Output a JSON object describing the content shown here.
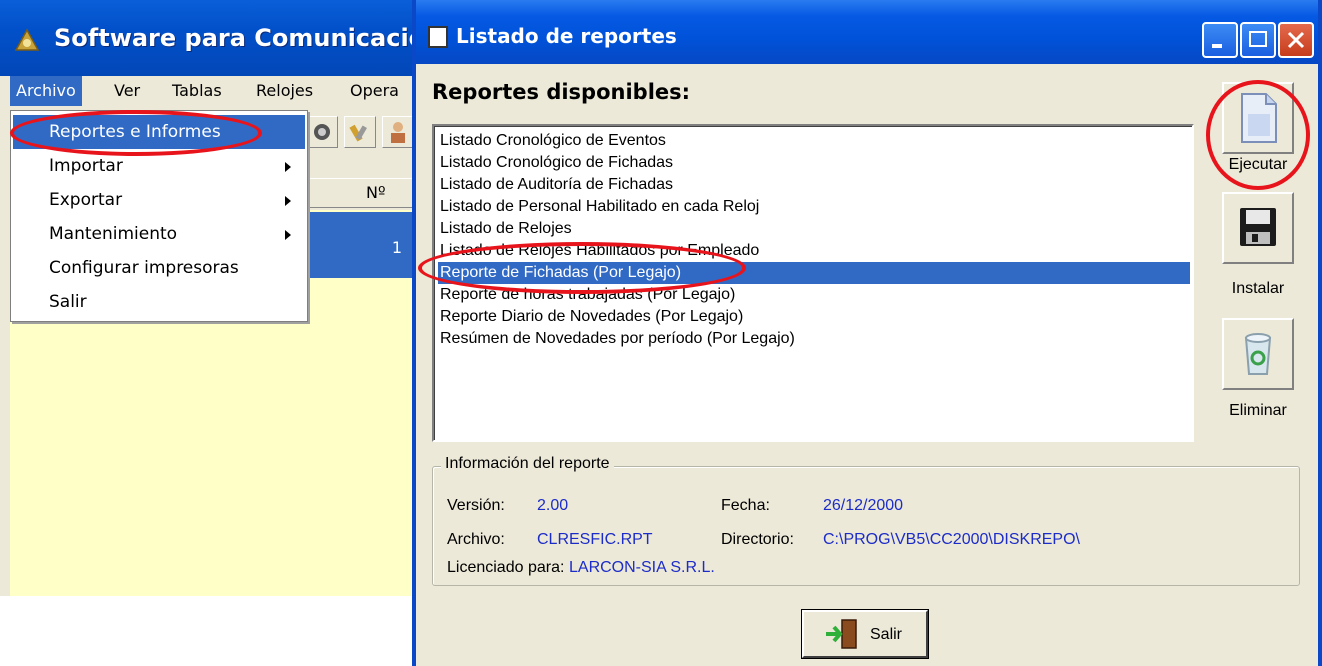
{
  "back_window": {
    "title": "Software para Comunicacione",
    "menu": [
      "Archivo",
      "Ver",
      "Tablas",
      "Relojes",
      "Opera"
    ],
    "column_header": "Nº",
    "selected_row_value": "1"
  },
  "archivo_menu": {
    "items": [
      {
        "label": "Reportes e Informes",
        "submenu": false
      },
      {
        "label": "Importar",
        "submenu": true
      },
      {
        "label": "Exportar",
        "submenu": true
      },
      {
        "label": "Mantenimiento",
        "submenu": true
      },
      {
        "label": "Configurar impresoras",
        "submenu": false
      },
      {
        "label": "Salir",
        "submenu": false
      }
    ],
    "selected_index": 0
  },
  "dialog": {
    "title": "Listado de reportes",
    "heading": "Reportes disponibles:",
    "reports": [
      "Listado Cronológico de Eventos",
      "Listado Cronológico de Fichadas",
      "Listado de Auditoría de Fichadas",
      "Listado de Personal Habilitado en cada Reloj",
      "Listado de Relojes",
      "Listado de Relojes Habilitados por Empleado",
      "Reporte de Fichadas (Por Legajo)",
      "Reporte de horas trabajadas (Por Legajo)",
      "Reporte Diario de Novedades (Por Legajo)",
      "Resúmen de Novedades por período (Por Legajo)"
    ],
    "selected_report_index": 6,
    "buttons": {
      "ejecutar": "Ejecutar",
      "instalar": "Instalar",
      "eliminar": "Eliminar",
      "salir": "Salir"
    },
    "info": {
      "legend": "Información del reporte",
      "version_label": "Versión:",
      "version": "2.00",
      "fecha_label": "Fecha:",
      "fecha": "26/12/2000",
      "archivo_label": "Archivo:",
      "archivo": "CLRESFIC.RPT",
      "directorio_label": "Directorio:",
      "directorio": "C:\\PROG\\VB5\\CC2000\\DISKREPO\\",
      "licenciado_label": "Licenciado para:",
      "licenciado": "LARCON-SIA S.R.L."
    }
  },
  "colors": {
    "title_blue": "#0052d9",
    "selection": "#316ac5",
    "annotation_red": "#e8141c",
    "info_value": "#1c2cc8"
  }
}
